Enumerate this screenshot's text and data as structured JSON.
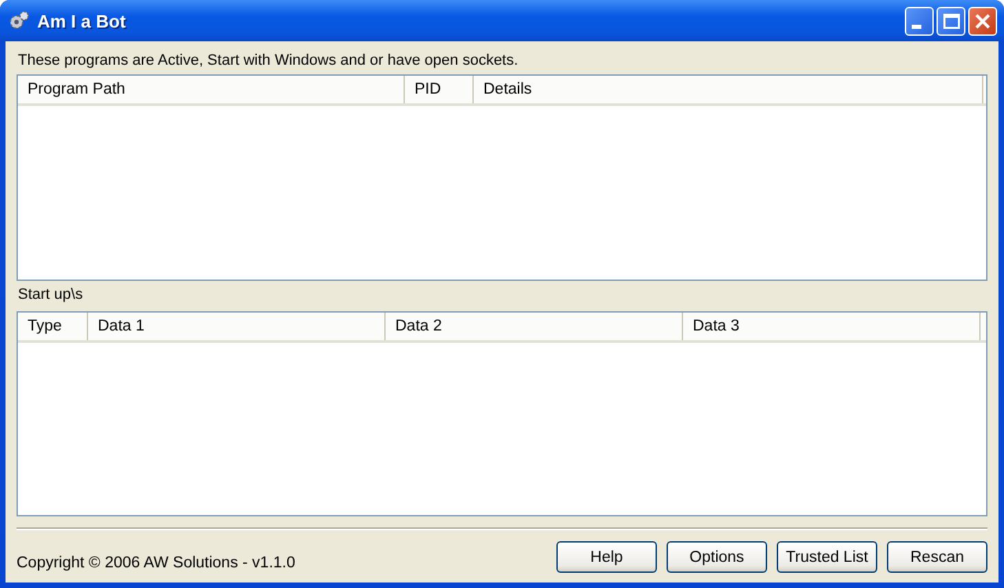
{
  "window": {
    "title": "Am I a Bot"
  },
  "active_label": "These programs are Active, Start with Windows and or have open sockets.",
  "programs_table": {
    "columns": [
      {
        "label": "Program Path"
      },
      {
        "label": "PID"
      },
      {
        "label": "Details"
      }
    ]
  },
  "startup_label": "Start up\\s",
  "startup_table": {
    "columns": [
      {
        "label": "Type"
      },
      {
        "label": "Data 1"
      },
      {
        "label": "Data 2"
      },
      {
        "label": "Data 3"
      }
    ]
  },
  "copyright": "Copyright © 2006 AW Solutions - v1.1.0",
  "buttons": [
    "Help",
    "Options",
    "Trusted List",
    "Rescan"
  ]
}
